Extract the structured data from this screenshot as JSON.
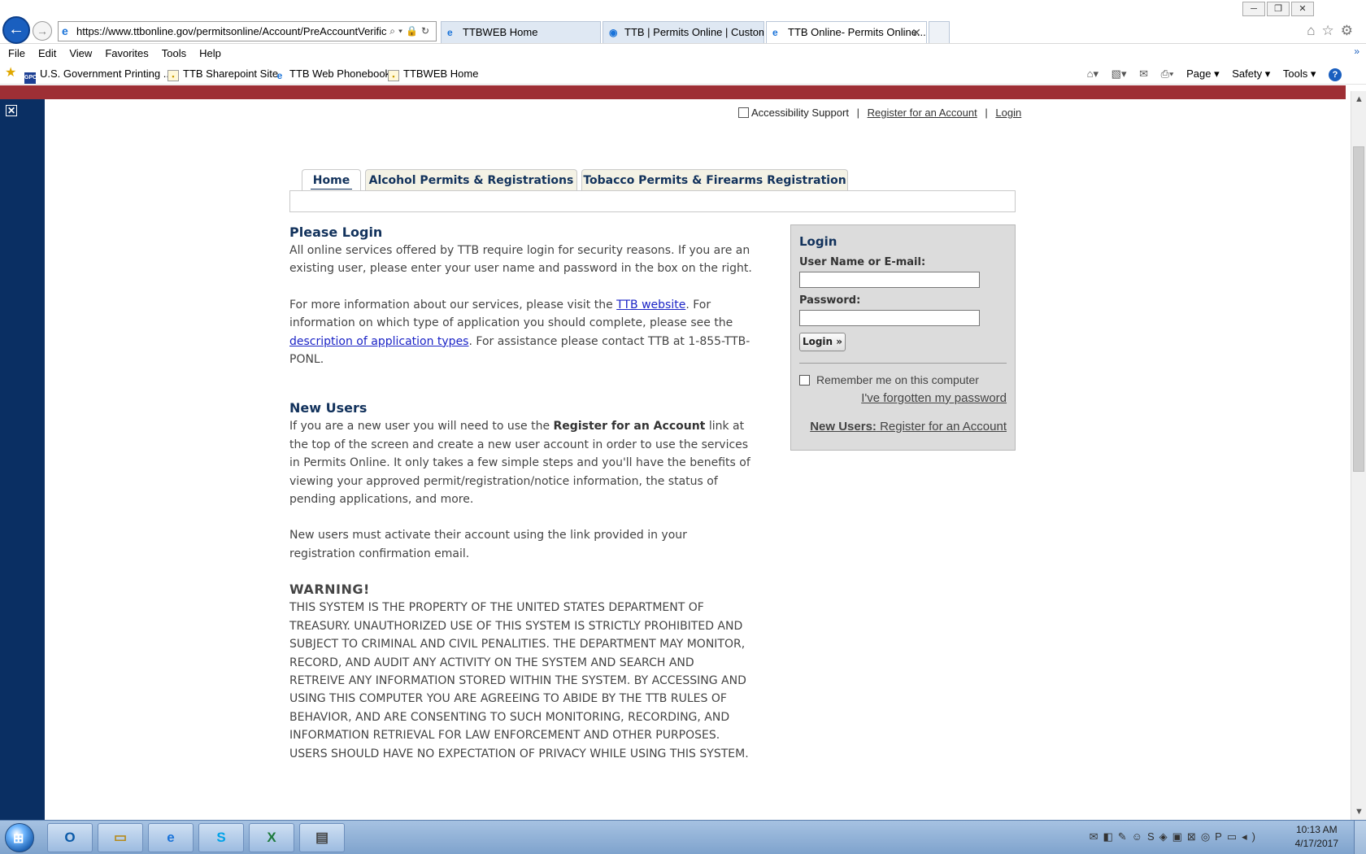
{
  "browser": {
    "address": "https://www.ttbonline.gov/permitsonline/Account/PreAccountVerific",
    "address_host": "ttbonline.gov",
    "tabs": [
      {
        "label": "TTBWEB Home",
        "icon": "ie-icon",
        "active": false
      },
      {
        "label": "TTB | Permits Online | Custom...",
        "icon": "ttb-seal-icon",
        "active": false
      },
      {
        "label": "TTB Online- Permits Online...",
        "icon": "ie-icon",
        "active": true
      }
    ],
    "close_glyph": "✕"
  },
  "menubar": {
    "items": [
      "File",
      "Edit",
      "View",
      "Favorites",
      "Tools",
      "Help"
    ]
  },
  "favorites": {
    "items": [
      {
        "label": "U.S. Government Printing ...",
        "icon": "gpo-icon"
      },
      {
        "label": "TTB Sharepoint Site",
        "icon": "page-icon"
      },
      {
        "label": "TTB Web Phonebook",
        "icon": "ie-icon"
      },
      {
        "label": "TTBWEB Home",
        "icon": "page-icon"
      }
    ],
    "commands": [
      "Page ▾",
      "Safety ▾",
      "Tools ▾"
    ]
  },
  "page": {
    "top_links": {
      "accessibility": "Accessibility Support",
      "register": "Register for an Account",
      "login": "Login"
    },
    "tabs": [
      {
        "label": "Home",
        "active": true
      },
      {
        "label": "Alcohol Permits & Registrations",
        "active": false
      },
      {
        "label": "Tobacco Permits & Firearms Registration",
        "active": false
      }
    ],
    "please_login": {
      "heading": "Please Login",
      "para1": "All online services offered by TTB require login for security reasons.  If you are an existing user, please enter your user name and password in the box on the right.",
      "para2_a": "For more information about our services, please visit the ",
      "para2_link1": "TTB website",
      "para2_b": ".  For information on which type of application you should complete, please see the ",
      "para2_link2": "description of application types",
      "para2_c": ". For assistance please contact TTB at 1-855-TTB-PONL."
    },
    "new_users": {
      "heading": "New Users",
      "para1_a": "If you are a new user you will need to use the ",
      "para1_bold": "Register for an Account",
      "para1_b": " link at the top of the screen and create a new user account in order to use the services in Permits Online.   It only takes a few simple steps and you'll have the benefits of viewing your approved permit/registration/notice information, the status of pending applications, and more.",
      "para2": "New users must activate their account using the link provided in your registration confirmation email."
    },
    "warning": {
      "heading": "WARNING!",
      "text": "THIS SYSTEM IS THE PROPERTY OF THE UNITED STATES DEPARTMENT OF TREASURY.  UNAUTHORIZED USE OF THIS SYSTEM IS STRICTLY PROHIBITED AND SUBJECT TO CRIMINAL AND CIVIL PENALITIES.  THE DEPARTMENT MAY MONITOR, RECORD, AND AUDIT ANY ACTIVITY ON THE SYSTEM AND SEARCH AND RETREIVE ANY INFORMATION STORED WITHIN THE SYSTEM.  BY ACCESSING AND USING THIS COMPUTER YOU ARE AGREEING TO ABIDE BY THE TTB RULES OF BEHAVIOR, AND ARE CONSENTING TO SUCH MONITORING, RECORDING, AND INFORMATION RETRIEVAL FOR LAW ENFORCEMENT AND OTHER PURPOSES.  USERS SHOULD HAVE NO EXPECTATION OF PRIVACY WHILE USING THIS SYSTEM."
    },
    "login_box": {
      "title": "Login",
      "username_label": "User Name or E-mail:",
      "username_value": "",
      "password_label": "Password:",
      "password_value": "",
      "button": "Login »",
      "remember": "Remember me on this computer",
      "forgot": "I've forgotten my password",
      "new_users_label": "New Users:",
      "new_users_link": " Register for an Account"
    }
  },
  "taskbar": {
    "apps": [
      {
        "name": "outlook",
        "glyph": "O"
      },
      {
        "name": "explorer",
        "glyph": "▭"
      },
      {
        "name": "ie",
        "glyph": "e"
      },
      {
        "name": "skype",
        "glyph": "S"
      },
      {
        "name": "excel",
        "glyph": "X"
      },
      {
        "name": "window",
        "glyph": "▤"
      }
    ],
    "time": "10:13 AM",
    "date": "4/17/2017"
  },
  "colors": {
    "brand_red": "#9e2f35",
    "navy": "#0a2f63",
    "heading_navy": "#12325c",
    "link_blue": "#1a23c6"
  }
}
